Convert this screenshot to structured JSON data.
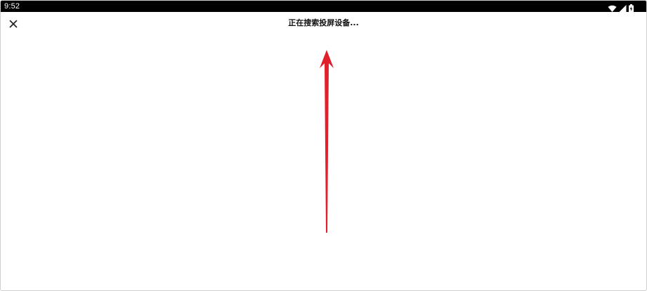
{
  "status_bar": {
    "time": "9:52",
    "icons": [
      "wifi-icon",
      "cellular-signal-icon",
      "battery-charging-icon"
    ]
  },
  "toolbar": {
    "close_icon": "close-icon",
    "title": "正在搜索投屏设备..."
  },
  "annotation": {
    "arrow_color": "#e0202a",
    "arrow_direction": "up"
  },
  "colors": {
    "status_bar_bg": "#000000",
    "background": "#ffffff",
    "title_text": "#111111"
  }
}
